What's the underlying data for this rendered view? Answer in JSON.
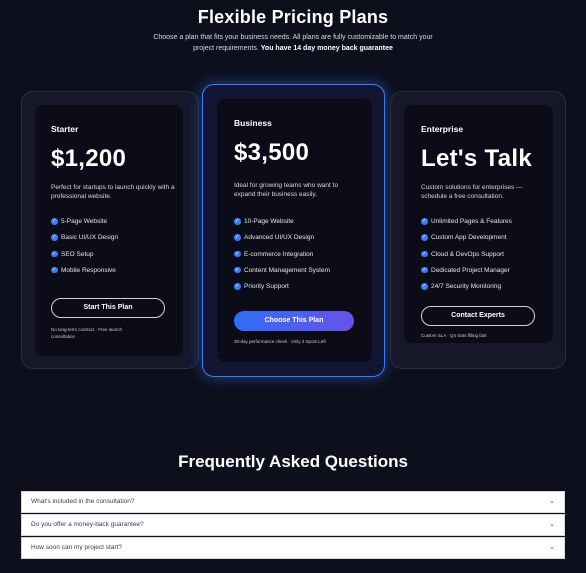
{
  "header": {
    "title": "Flexible Pricing Plans",
    "subtitle": "Choose a plan that fits your business needs. All plans are fully customizable to match your project requirements.",
    "subtitle_bold": "You have 14 day money back guarantee"
  },
  "plans": [
    {
      "name": "Starter",
      "price": "$1,200",
      "description": "Perfect for startups to launch quickly with a professional website.",
      "features": [
        "5-Page Website",
        "Basic UI/UX Design",
        "SEO Setup",
        "Mobile Responsive"
      ],
      "button": "Start This Plan",
      "note": "No long-term contract · Free launch consultation"
    },
    {
      "name": "Business",
      "price": "$3,500",
      "description": "Ideal for growing teams who want to expand their business easily.",
      "features": [
        "10-Page Website",
        "Advanced UI/UX Design",
        "E-commerce Integration",
        "Content Management System",
        "Priority Support"
      ],
      "button": "Choose This Plan",
      "note": "30-day performance check · Only 3 Spots Left"
    },
    {
      "name": "Enterprise",
      "price": "Let's Talk",
      "description": "Custom solutions for enterprises — schedule a free consultation.",
      "features": [
        "Unlimited Pages & Features",
        "Custom App Development",
        "Cloud & DevOps Support",
        "Dedicated Project Manager",
        "24/7 Security Monitoring"
      ],
      "button": "Contact Experts",
      "note": "Custom SLA · Q4 slots filling fast"
    }
  ],
  "faq": {
    "title": "Frequently Asked Questions",
    "items": [
      "What's included in the consultation?",
      "Do you offer a money-back guarantee?",
      "How soon can my project start?"
    ]
  },
  "colors": {
    "background": "#0d0f1d",
    "accent": "#3a7cf2",
    "accent_gradient_end": "#6a52e8"
  },
  "icons": {
    "feature": "check-circle-icon",
    "faq": "chevron-down-icon"
  }
}
